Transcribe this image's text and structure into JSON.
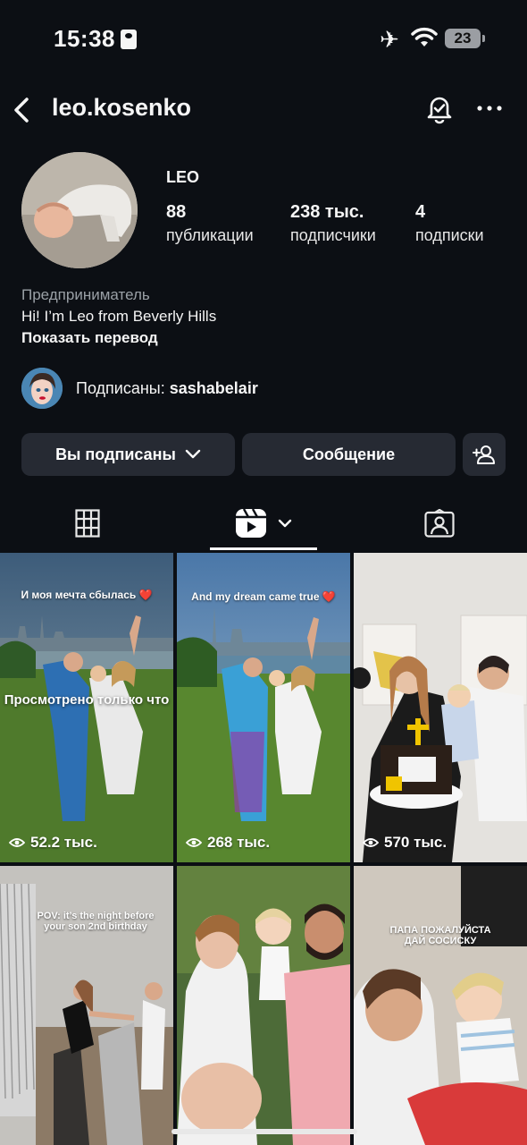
{
  "status_bar": {
    "time": "15:38",
    "battery": "23"
  },
  "header": {
    "username": "leo.kosenko"
  },
  "profile": {
    "name": "LEO",
    "stats": [
      {
        "value": "88",
        "label": "публикации"
      },
      {
        "value": "238 тыс.",
        "label": "подписчики"
      },
      {
        "value": "4",
        "label": "подписки"
      }
    ],
    "category": "Предприниматель",
    "bio": "Hi! I’m Leo from Beverly Hills",
    "translate_label": "Показать перевод",
    "followed_by_prefix": "Подписаны:",
    "followed_by_user": "sashabelair"
  },
  "buttons": {
    "following_label": "Вы подписаны",
    "message_label": "Сообщение"
  },
  "tabs": [
    {
      "name": "grid",
      "icon": "grid-icon"
    },
    {
      "name": "reels",
      "icon": "reels-icon",
      "active": true
    },
    {
      "name": "tagged",
      "icon": "tagged-icon"
    }
  ],
  "grid": {
    "posts": [
      {
        "caption": "И моя мечта сбылась ❤️",
        "views": "52.2 тыс.",
        "overlay": "Просмотрено только что"
      },
      {
        "caption": "And my dream came true ❤️",
        "views": "268 тыс."
      },
      {
        "caption": "",
        "views": "570 тыс."
      },
      {
        "caption": "POV: it’s the night before your son 2nd birthday",
        "views": ""
      },
      {
        "caption": "",
        "views": ""
      },
      {
        "caption": "ПАПА ПОЖАЛУЙСТА ДАЙ СОСИСКУ",
        "views": ""
      }
    ]
  },
  "colors": {
    "background": "#0c0f14",
    "button": "#262a33",
    "muted": "#9aa0a6"
  }
}
